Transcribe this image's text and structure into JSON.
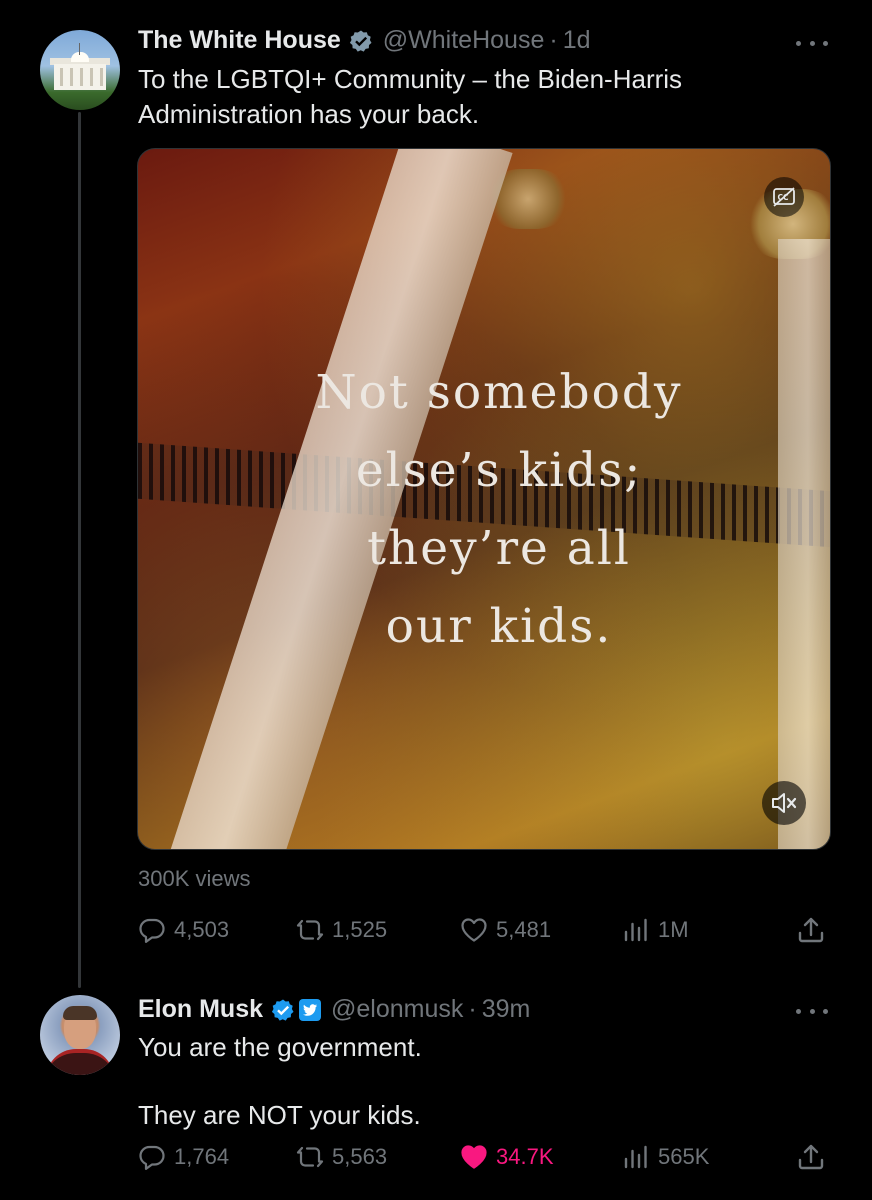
{
  "tweets": [
    {
      "author": {
        "name": "The White House",
        "handle": "@WhiteHouse",
        "time": "1d",
        "verified_badge": "gov-gray-check-icon"
      },
      "text": "To the LGBTQI+ Community – the Biden-Harris\nAdministration has your back.",
      "media": {
        "overlay_text": "Not somebody\nelse’s kids;\nthey’re all\nour kids.",
        "cc_icon": "captions-off-icon",
        "mute_icon": "volume-muted-icon"
      },
      "views": "300K views",
      "actions": {
        "replies": "4,503",
        "reposts": "1,525",
        "likes": "5,481",
        "impressions": "1M"
      }
    },
    {
      "author": {
        "name": "Elon Musk",
        "handle": "@elonmusk",
        "time": "39m",
        "verified_badge": "blue-check-icon",
        "affiliation_badge": "twitter-bird-icon"
      },
      "text": "You are the government.\n\nThey are NOT your kids.",
      "actions": {
        "replies": "1,764",
        "reposts": "5,563",
        "likes": "34.7K",
        "liked": true,
        "impressions": "565K"
      }
    }
  ],
  "colors": {
    "background": "#000000",
    "text_primary": "#e7e9ea",
    "text_secondary": "#71767b",
    "like_active": "#f91880",
    "verified_blue": "#1d9bf0",
    "verified_gray": "#829aab"
  }
}
